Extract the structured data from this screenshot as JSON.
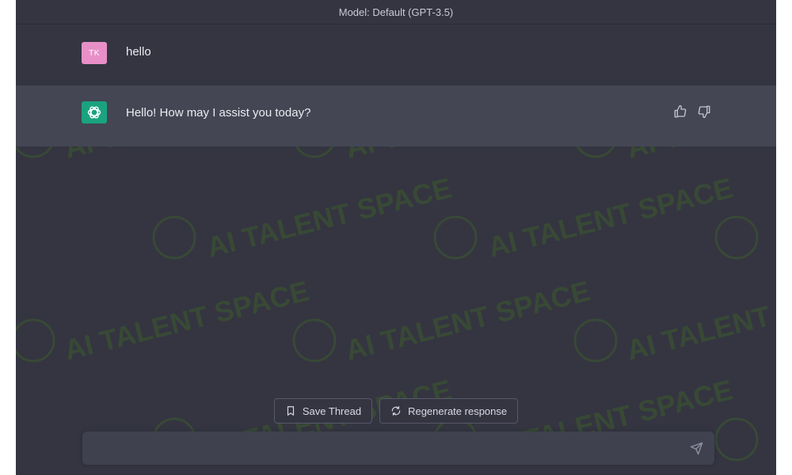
{
  "header": {
    "model_label": "Model: Default (GPT-3.5)"
  },
  "messages": [
    {
      "role": "user",
      "avatar_initials": "TK",
      "text": "hello"
    },
    {
      "role": "assistant",
      "avatar_icon": "openai-logo-icon",
      "text": "Hello! How may I assist you today?"
    }
  ],
  "feedback": {
    "icons": [
      "thumbs-up-icon",
      "thumbs-down-icon"
    ]
  },
  "actions": {
    "save_thread_label": "Save Thread",
    "regenerate_label": "Regenerate response"
  },
  "composer": {
    "value": "",
    "placeholder": ""
  },
  "watermark": {
    "text": "AI TALENT SPACE"
  },
  "colors": {
    "background": "#343541",
    "assistant_row": "#444654",
    "user_avatar": "#e88fc8",
    "bot_avatar": "#19a37f",
    "watermark": "#3d5a2e"
  }
}
